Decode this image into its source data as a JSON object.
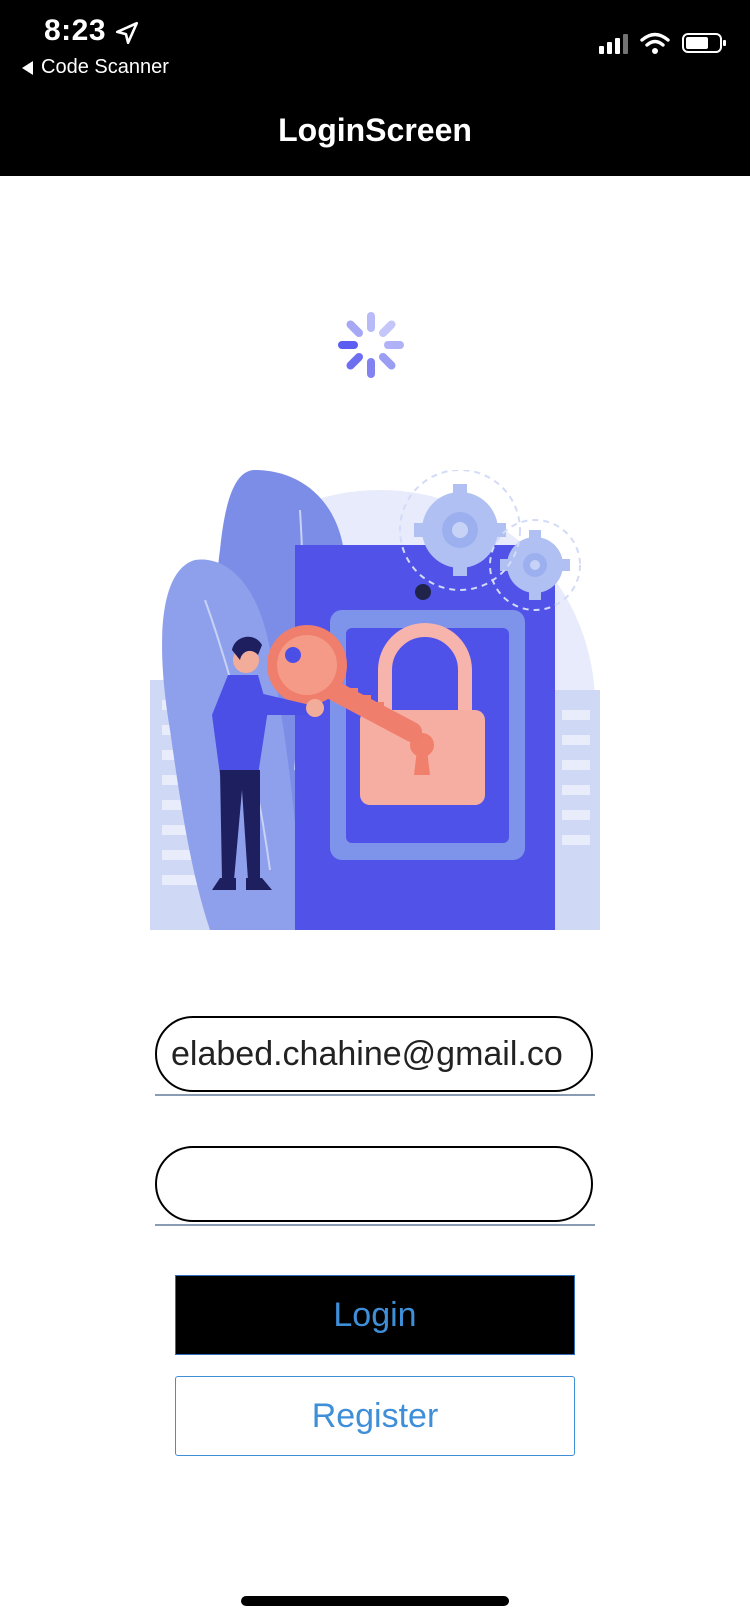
{
  "status_bar": {
    "time": "8:23",
    "back_app": "Code Scanner",
    "icons": [
      "location-arrow-icon",
      "signal-icon",
      "wifi-icon",
      "battery-icon"
    ]
  },
  "nav": {
    "title": "LoginScreen"
  },
  "loading": {
    "icon": "spinner-icon",
    "color": "#5b5ef0"
  },
  "illustration": {
    "icon": "unlock-padlock-key-illustration"
  },
  "form": {
    "email_value": "elabed.chahine@gmail.co",
    "password_value": ""
  },
  "buttons": {
    "login_label": "Login",
    "register_label": "Register",
    "accent": "#3f8fd8"
  }
}
